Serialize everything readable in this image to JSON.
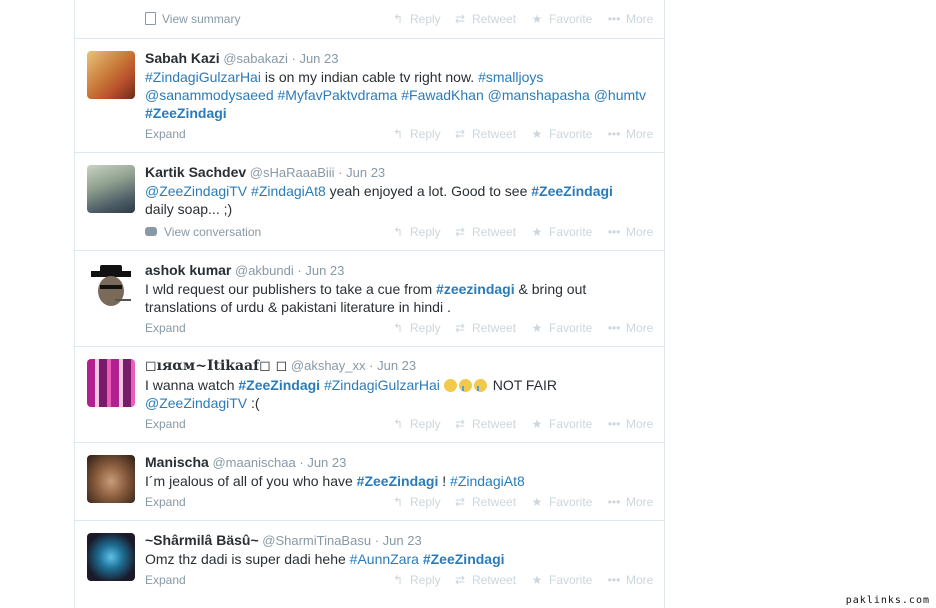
{
  "top": {
    "summary": "View summary"
  },
  "actions": {
    "reply": "Reply",
    "retweet": "Retweet",
    "favorite": "Favorite",
    "more": "More"
  },
  "tweets": [
    {
      "name": "Sabah Kazi",
      "handle": "@sabakazi",
      "sep": "·",
      "time": "Jun 23",
      "line1a": "#ZindagiGulzarHai",
      "line1b": " is on my indian cable tv right now. ",
      "line1c": "#smalljoys",
      "line2a": "@sanammodysaeed",
      "line2b": "#MyfavPaktvdrama",
      "line2c": "#FawadKhan",
      "line2d": "@manshapasha",
      "line2e": "@humtv",
      "line3a": "#ZeeZindagi",
      "expand": "Expand"
    },
    {
      "name": "Kartik Sachdev",
      "handle": "@sHaRaaaBiii",
      "sep": "·",
      "time": "Jun 23",
      "line1a": "@ZeeZindagiTV",
      "line1b": "#ZindagiAt8",
      "line1c": " yeah enjoyed a lot. Good to see ",
      "line1d": "#ZeeZindagi",
      "line2": "daily soap... ;)",
      "expand": "View conversation"
    },
    {
      "name": "ashok kumar",
      "handle": "@akbundi",
      "sep": "·",
      "time": "Jun 23",
      "line1a": "I wld request our publishers to take a cue from ",
      "line1b": "#zeezindagi",
      "line1c": " & bring out",
      "line2": "translations of urdu & pakistani literature in hindi .",
      "expand": "Expand"
    },
    {
      "name": "◻ıяαм~Itikaaf◻ ◻",
      "handle": "@akshay_xx",
      "sep": "·",
      "time": "Jun 23",
      "line1a": "I wanna watch ",
      "line1b": "#ZeeZindagi",
      "line1c": "#ZindagiGulzarHai",
      "line1d": " NOT FAIR",
      "line2": "@ZeeZindagiTV",
      "line2b": " :(",
      "expand": "Expand"
    },
    {
      "name": "Manischa",
      "handle": "@maanischaa",
      "sep": "·",
      "time": "Jun 23",
      "line1a": "I´m jealous of all of you who have ",
      "line1b": "#ZeeZindagi",
      "line1c": " ! ",
      "line1d": "#ZindagiAt8",
      "expand": "Expand"
    },
    {
      "name": "~Shârmilâ Bäsû~",
      "handle": "@SharmiTinaBasu",
      "sep": "·",
      "time": "Jun 23",
      "line1a": "Omz thz dadi is super dadi hehe ",
      "line1b": "#AunnZara",
      "line1c": "#ZeeZindagi",
      "expand": "Expand"
    }
  ],
  "watermark": "paklinks.com"
}
